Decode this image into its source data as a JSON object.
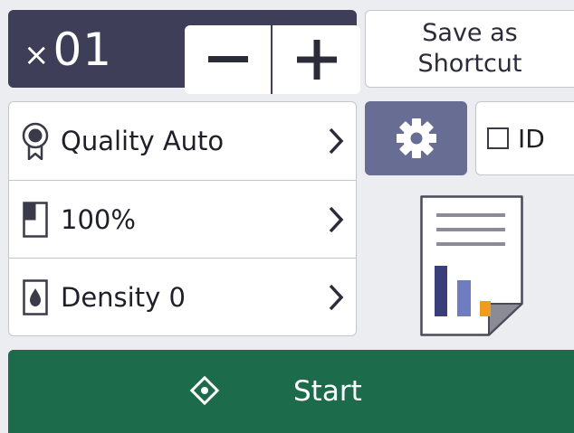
{
  "copies": {
    "prefix": "×",
    "value": "01",
    "decrement_icon": "minus-icon",
    "increment_icon": "plus-icon"
  },
  "shortcut": {
    "line1": "Save as",
    "line2": "Shortcut"
  },
  "settings": [
    {
      "icon": "quality-ribbon-icon",
      "label": "Quality Auto"
    },
    {
      "icon": "page-size-icon",
      "label": "100%"
    },
    {
      "icon": "density-drop-icon",
      "label": "Density 0"
    }
  ],
  "gear": {
    "icon": "gear-icon"
  },
  "id_option": {
    "label": "ID",
    "checked": false
  },
  "preview": {
    "icon": "document-preview-icon"
  },
  "start": {
    "label": "Start",
    "icon": "start-diamond-icon"
  },
  "colors": {
    "counter_bg": "#3e3e58",
    "gear_bg": "#676d93",
    "start_bg": "#1c6b4a",
    "screen_bg": "#ecedf0",
    "chart_blue_dark": "#3a3f7a",
    "chart_blue_light": "#6f7cc0",
    "chart_orange": "#f29b1d"
  }
}
